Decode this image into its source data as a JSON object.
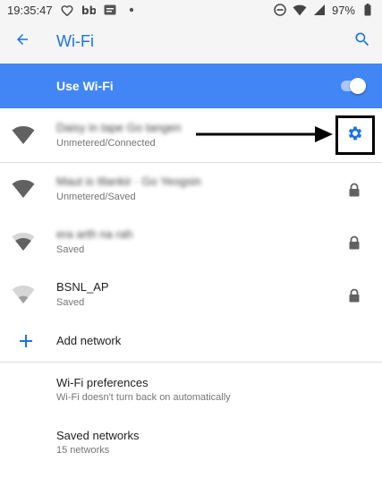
{
  "status_bar": {
    "time": "19:35:47",
    "battery": "97%"
  },
  "app_bar": {
    "title": "Wi-Fi",
    "back_icon": "arrow-back-icon",
    "search_icon": "search-icon"
  },
  "master_switch": {
    "label": "Use Wi-Fi",
    "on": true
  },
  "networks": [
    {
      "name": "Daisy in tape Go tangen",
      "status": "Unmetered/Connected",
      "action": "gear-icon",
      "signal": "strong"
    },
    {
      "name": "Maut is Itlankir · Go Yeogsin",
      "status": "Unmetered/Saved",
      "action": "lock-icon",
      "signal": "strong"
    },
    {
      "name": "era arth na rah",
      "status": "Saved",
      "action": "lock-icon",
      "signal": "medium"
    },
    {
      "name": "BSNL_AP",
      "status": "Saved",
      "action": "lock-icon",
      "signal": "weak"
    }
  ],
  "add_network": {
    "label": "Add network"
  },
  "preferences": {
    "title": "Wi-Fi preferences",
    "subtitle": "Wi-Fi doesn't turn back on automatically"
  },
  "saved_networks": {
    "title": "Saved networks",
    "subtitle": "15 networks"
  },
  "colors": {
    "accent": "#4285f4",
    "title_blue": "#1a73e8",
    "annotation": "#000000"
  }
}
